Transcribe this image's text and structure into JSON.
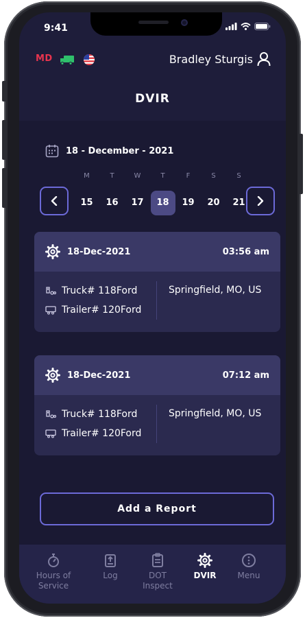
{
  "status_bar": {
    "time": "9:41"
  },
  "top": {
    "md_label": "MD",
    "user_name": "Bradley Sturgis"
  },
  "header": {
    "title": "DVIR"
  },
  "date": {
    "selected_label": "18 - December - 2021",
    "weekdays": [
      "M",
      "T",
      "W",
      "T",
      "F",
      "S",
      "S"
    ],
    "days": [
      "15",
      "16",
      "17",
      "18",
      "19",
      "20",
      "21"
    ],
    "selected_day": "18"
  },
  "reports": [
    {
      "date": "18-Dec-2021",
      "time": "03:56 am",
      "truck": "Truck# 118Ford",
      "trailer": "Trailer# 120Ford",
      "location": "Springfield, MO, US"
    },
    {
      "date": "18-Dec-2021",
      "time": "07:12 am",
      "truck": "Truck# 118Ford",
      "trailer": "Trailer# 120Ford",
      "location": "Springfield, MO, US"
    }
  ],
  "add_button": "Add a Report",
  "tabs": [
    {
      "label": "Hours of Service",
      "icon": "stopwatch-icon",
      "active": false
    },
    {
      "label": "Log",
      "icon": "log-icon",
      "active": false
    },
    {
      "label": "DOT Inspect",
      "icon": "clipboard-icon",
      "active": false
    },
    {
      "label": "DVIR",
      "icon": "gear-icon",
      "active": true
    },
    {
      "label": "Menu",
      "icon": "menu-icon",
      "active": false
    }
  ],
  "colors": {
    "background": "#1e1d3a",
    "card": "#2b2a4f",
    "card_header": "#3a3966",
    "accent_border": "#6c6ad8",
    "md_red": "#e8344e",
    "truck_green": "#2fbf6b"
  }
}
